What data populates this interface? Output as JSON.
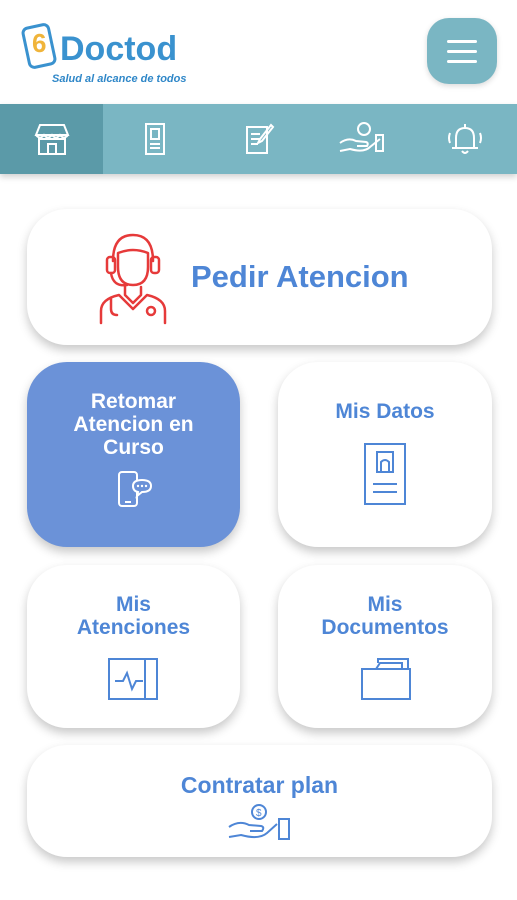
{
  "header": {
    "logo_text": "Doctod",
    "logo_tagline": "Salud al alcance de todos",
    "menu_icon": "hamburger-icon"
  },
  "nav": {
    "items": [
      {
        "icon": "home-icon",
        "active": true
      },
      {
        "icon": "id-card-icon",
        "active": false
      },
      {
        "icon": "clipboard-edit-icon",
        "active": false
      },
      {
        "icon": "hand-coin-icon",
        "active": false
      },
      {
        "icon": "bell-icon",
        "active": false
      }
    ]
  },
  "cards": {
    "pedir": {
      "label": "Pedir Atencion",
      "icon": "doctor-headset-icon"
    },
    "retomar": {
      "line1": "Retomar",
      "line2": "Atencion en",
      "line3": "Curso",
      "icon": "phone-chat-icon"
    },
    "datos": {
      "label": "Mis Datos",
      "icon": "id-card-icon"
    },
    "atenciones": {
      "line1": "Mis",
      "line2": "Atenciones",
      "icon": "monitor-heartbeat-icon"
    },
    "documentos": {
      "line1": "Mis",
      "line2": "Documentos",
      "icon": "folder-icon"
    },
    "plan": {
      "label": "Contratar plan",
      "icon": "hand-coin-icon"
    }
  },
  "colors": {
    "nav_bg": "#7ab6c3",
    "nav_active": "#5b9aa8",
    "accent_blue": "#4e86d6",
    "card_blue": "#6b92d8",
    "doctor_red": "#e63a3a"
  }
}
